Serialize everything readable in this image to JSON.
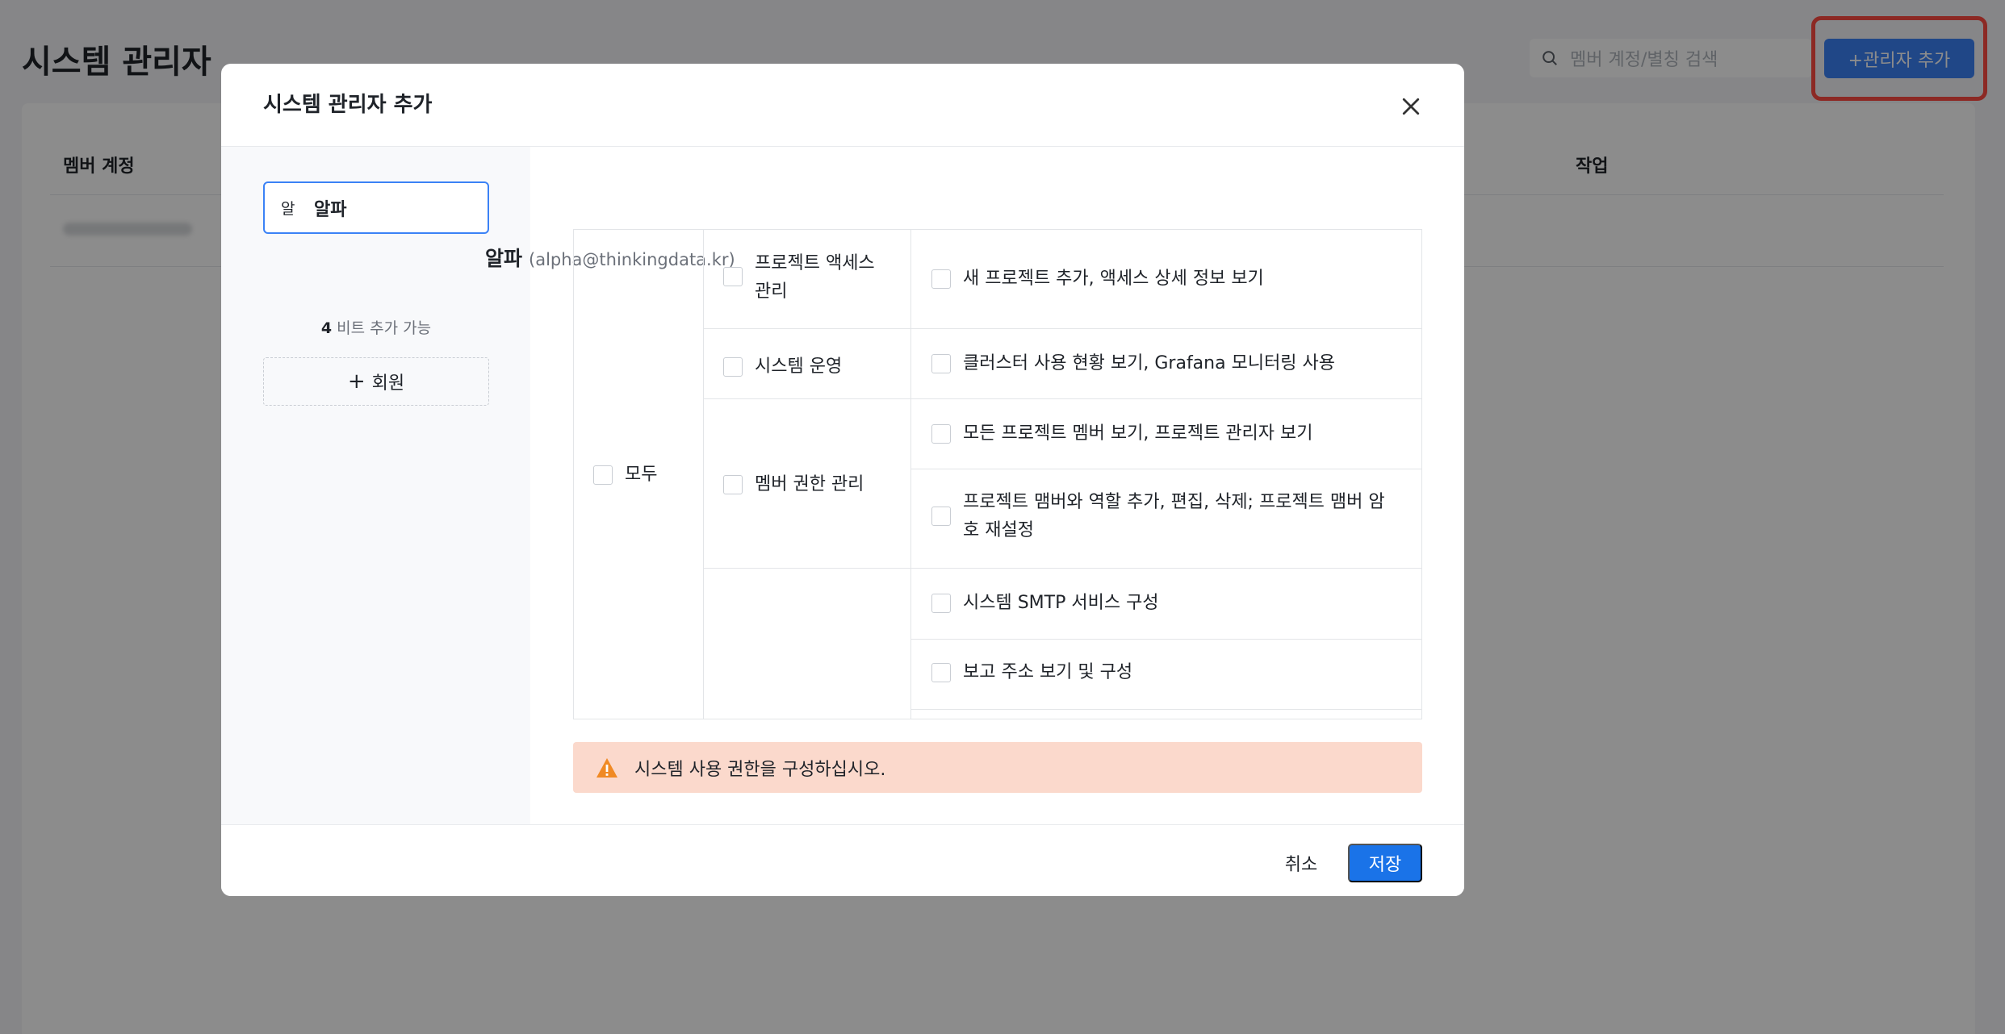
{
  "background": {
    "page_title": "시스템 관리자",
    "search_placeholder": "멤버 계정/별칭 검색",
    "add_button": "+관리자 추가",
    "col_member_account": "멤버 계정",
    "col_actions": "작업"
  },
  "modal": {
    "title": "시스템 관리자 추가",
    "member": {
      "avatar": "알",
      "name": "알파",
      "email": "(alpha@thinkingdata.kr)"
    },
    "add_count_number": "4",
    "add_count_text": " 비트 추가 가능",
    "add_member_label": "회원",
    "permissions": {
      "all_label": "모두",
      "groups": [
        {
          "label": "프로젝트 액세스 관리",
          "items": [
            "새 프로젝트 추가, 액세스 상세 정보 보기"
          ]
        },
        {
          "label": "시스템 운영",
          "items": [
            "클러스터 사용 현황 보기, Grafana 모니터링 사용"
          ]
        },
        {
          "label": "멤버 권한 관리",
          "items": [
            "모든 프로젝트 멤버 보기, 프로젝트 관리자 보기",
            "프로젝트 맴버와 역할 추가, 편집, 삭제; 프로젝트 맴버 암호 재설정"
          ]
        },
        {
          "label": "",
          "items": [
            "시스템 SMTP 서비스 구성",
            "보고 주소 보기 및 구성"
          ]
        }
      ]
    },
    "warning": "시스템 사용 권한을 구성하십시오.",
    "cancel": "취소",
    "save": "저장"
  },
  "colors": {
    "primary": "#1a73e8",
    "warning_bg": "#fbd9cc",
    "warning_icon": "#f08a24",
    "highlight_border": "#ff4b42"
  }
}
